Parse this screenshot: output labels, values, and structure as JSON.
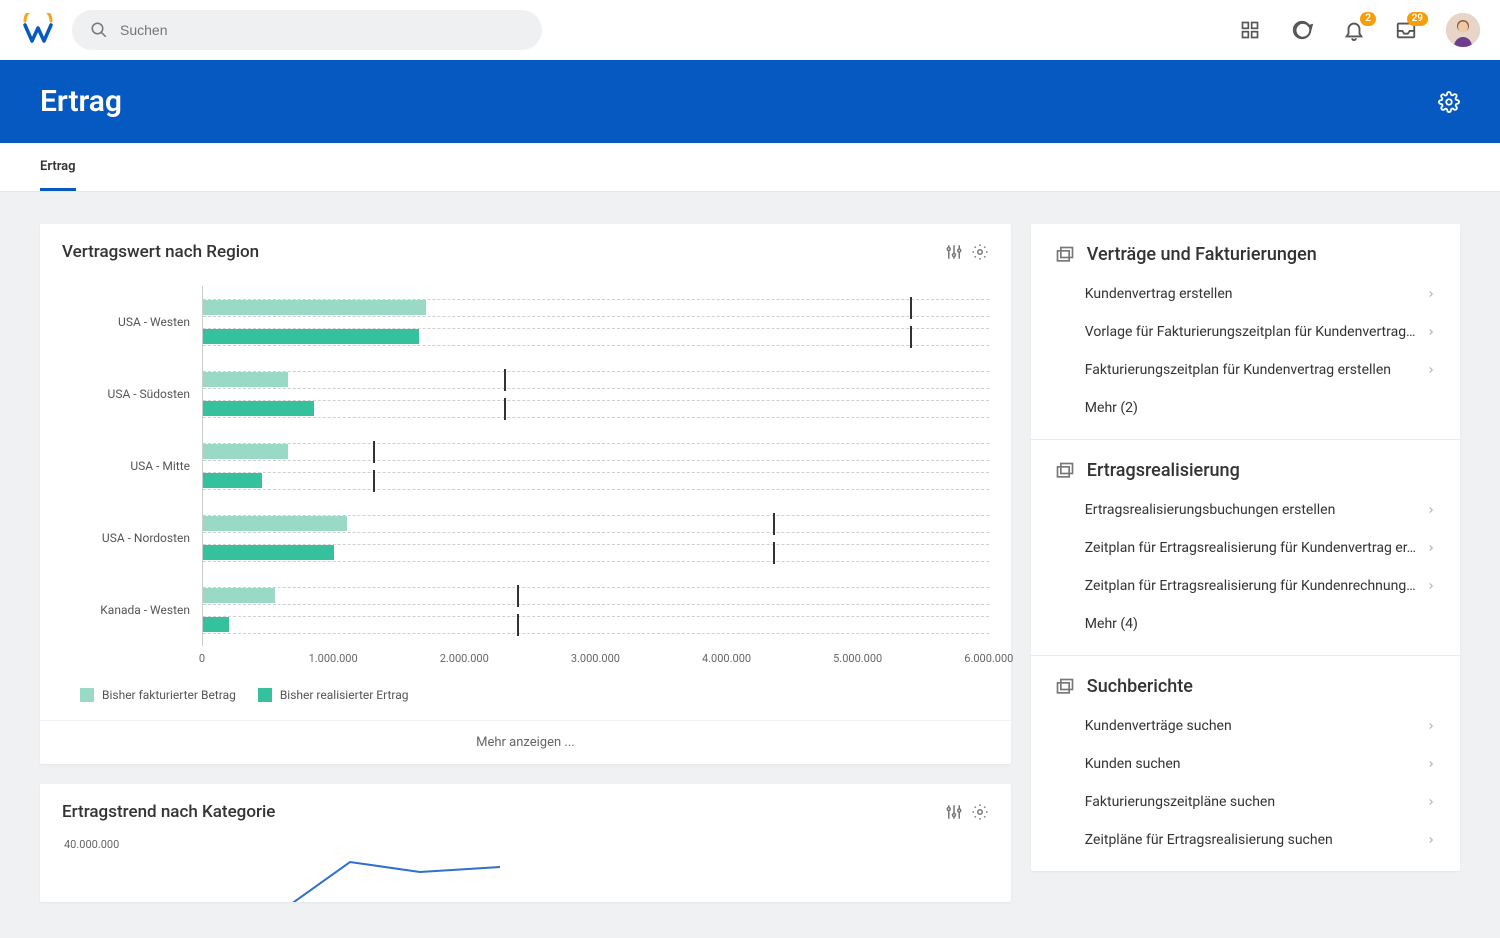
{
  "app": {
    "search_placeholder": "Suchen"
  },
  "topbar": {
    "notif_badge": "2",
    "inbox_badge": "29"
  },
  "page": {
    "title": "Ertrag"
  },
  "tabs": [
    "Ertrag"
  ],
  "chart_a": {
    "title": "Vertragswert nach Region",
    "show_more": "Mehr anzeigen ..."
  },
  "chart_data": {
    "type": "bar",
    "orientation": "horizontal",
    "title": "Vertragswert nach Region",
    "xlabel": "",
    "ylabel": "",
    "xlim": [
      0,
      6000000
    ],
    "x_ticks": [
      "0",
      "1.000.000",
      "2.000.000",
      "3.000.000",
      "4.000.000",
      "5.000.000",
      "6.000.000"
    ],
    "categories": [
      "USA - Westen",
      "USA - Südosten",
      "USA - Mitte",
      "USA - Nordosten",
      "Kanada - Westen"
    ],
    "series": [
      {
        "name": "Bisher fakturierter Betrag",
        "values": [
          1700000,
          650000,
          650000,
          1100000,
          550000
        ],
        "targets": [
          5400000,
          2300000,
          1300000,
          4350000,
          2400000
        ]
      },
      {
        "name": "Bisher realisierter Ertrag",
        "values": [
          1650000,
          850000,
          450000,
          1000000,
          200000
        ],
        "targets": [
          5400000,
          2300000,
          1300000,
          4350000,
          2400000
        ]
      }
    ],
    "legend": [
      "Bisher fakturierter Betrag",
      "Bisher realisierter Ertrag"
    ]
  },
  "chart_b": {
    "title": "Ertragstrend nach Kategorie",
    "y0": "40.000.000"
  },
  "right": {
    "sections": [
      {
        "title": "Verträge und Fakturierungen",
        "items": [
          "Kundenvertrag erstellen",
          "Vorlage für Fakturierungszeitplan für Kundenvertrag…",
          "Fakturierungszeitplan für Kundenvertrag erstellen"
        ],
        "more": "Mehr (2)"
      },
      {
        "title": "Ertragsrealisierung",
        "items": [
          "Ertragsrealisierungsbuchungen erstellen",
          "Zeitplan für Ertragsrealisierung für Kundenvertrag er…",
          "Zeitplan für Ertragsrealisierung für Kundenrechnung…"
        ],
        "more": "Mehr (4)"
      },
      {
        "title": "Suchberichte",
        "items": [
          "Kundenverträge suchen",
          "Kunden suchen",
          "Fakturierungszeitpläne suchen",
          "Zeitpläne für Ertragsrealisierung suchen"
        ],
        "more": ""
      }
    ]
  }
}
